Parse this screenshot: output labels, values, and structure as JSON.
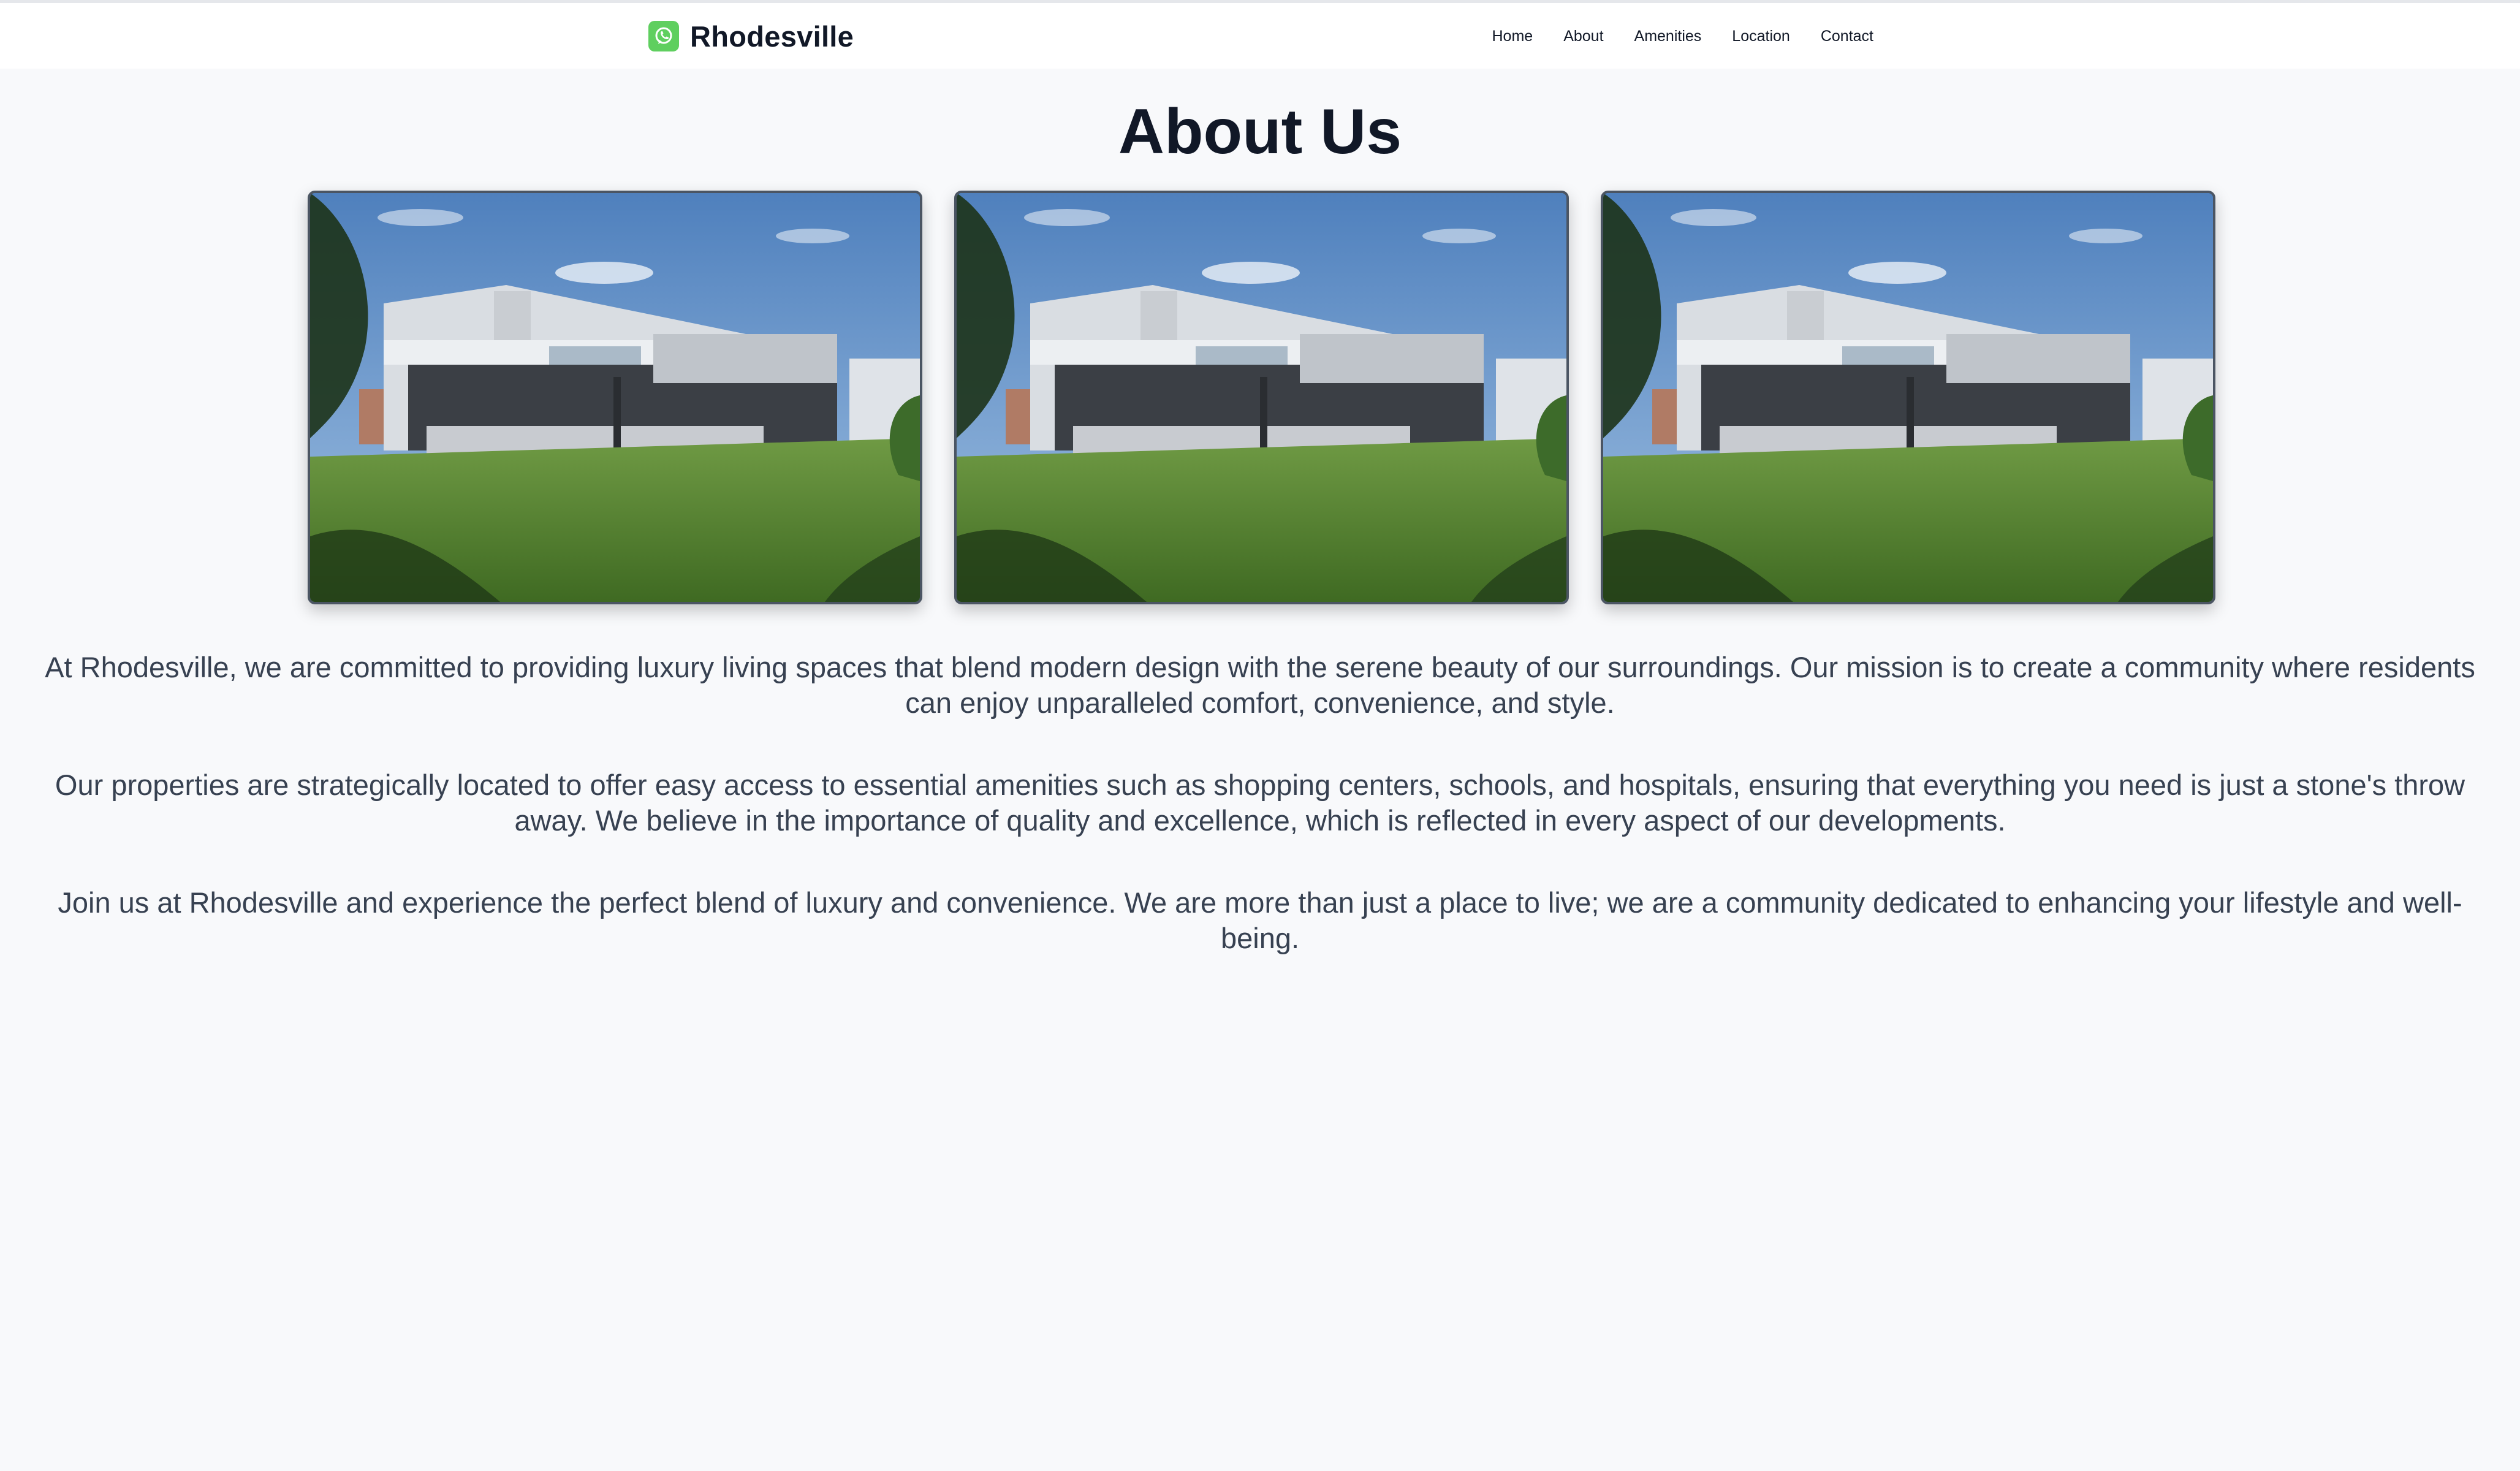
{
  "brand": {
    "name": "Rhodesville",
    "logo_icon": "whatsapp-icon",
    "logo_color": "#5fcf5f"
  },
  "nav": {
    "items": [
      {
        "label": "Home"
      },
      {
        "label": "About"
      },
      {
        "label": "Amenities"
      },
      {
        "label": "Location"
      },
      {
        "label": "Contact"
      }
    ]
  },
  "page": {
    "title": "About Us"
  },
  "gallery": {
    "images": [
      {
        "subject": "modern-house-photo"
      },
      {
        "subject": "modern-house-photo"
      },
      {
        "subject": "modern-house-photo"
      }
    ]
  },
  "content": {
    "paragraphs": [
      "At Rhodesville, we are committed to providing luxury living spaces that blend modern design with the serene beauty of our surroundings. Our mission is to create a community where residents can enjoy unparalleled comfort, convenience, and style.",
      "Our properties are strategically located to offer easy access to essential amenities such as shopping centers, schools, and hospitals, ensuring that everything you need is just a stone's throw away. We believe in the importance of quality and excellence, which is reflected in every aspect of our developments.",
      "Join us at Rhodesville and experience the perfect blend of luxury and convenience. We are more than just a place to live; we are a community dedicated to enhancing your lifestyle and well-being."
    ]
  },
  "colors": {
    "background": "#f8f9fb",
    "text": "#374151",
    "heading": "#111827"
  }
}
